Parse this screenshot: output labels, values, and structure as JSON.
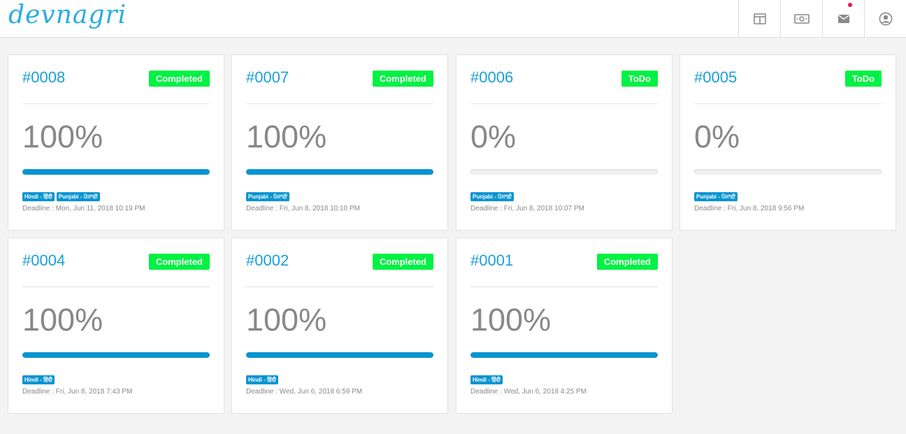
{
  "header": {
    "logo_text": "devnagri",
    "icons": [
      "layout-icon",
      "money-icon",
      "mail-icon",
      "user-account-icon"
    ]
  },
  "colors": {
    "accent": "#1a9fd8",
    "progress": "#0694d1",
    "status_badge": "#00f243",
    "notification_dot": "#f0134d"
  },
  "projects": [
    {
      "id": "#0008",
      "status": "Completed",
      "percent": "100%",
      "progress": 100,
      "languages": [
        "Hindi - हिंदी",
        "Punjabi - ਪੰਜਾਬੀ"
      ],
      "deadline": "Deadline : Mon, Jun 11, 2018 10:19 PM"
    },
    {
      "id": "#0007",
      "status": "Completed",
      "percent": "100%",
      "progress": 100,
      "languages": [
        "Punjabi - ਪੰਜਾਬੀ"
      ],
      "deadline": "Deadline : Fri, Jun 8, 2018 10:10 PM"
    },
    {
      "id": "#0006",
      "status": "ToDo",
      "percent": "0%",
      "progress": 0,
      "languages": [
        "Punjabi - ਪੰਜਾਬੀ"
      ],
      "deadline": "Deadline : Fri, Jun 8, 2018 10:07 PM"
    },
    {
      "id": "#0005",
      "status": "ToDo",
      "percent": "0%",
      "progress": 0,
      "languages": [
        "Punjabi - ਪੰਜਾਬੀ"
      ],
      "deadline": "Deadline : Fri, Jun 8, 2018 9:56 PM"
    },
    {
      "id": "#0004",
      "status": "Completed",
      "percent": "100%",
      "progress": 100,
      "languages": [
        "Hindi - हिंदी"
      ],
      "deadline": "Deadline : Fri, Jun 8, 2018 7:43 PM"
    },
    {
      "id": "#0002",
      "status": "Completed",
      "percent": "100%",
      "progress": 100,
      "languages": [
        "Hindi - हिंदी"
      ],
      "deadline": "Deadline : Wed, Jun 6, 2018 6:59 PM"
    },
    {
      "id": "#0001",
      "status": "Completed",
      "percent": "100%",
      "progress": 100,
      "languages": [
        "Hindi - हिंदी"
      ],
      "deadline": "Deadline : Wed, Jun 6, 2018 4:25 PM"
    }
  ]
}
